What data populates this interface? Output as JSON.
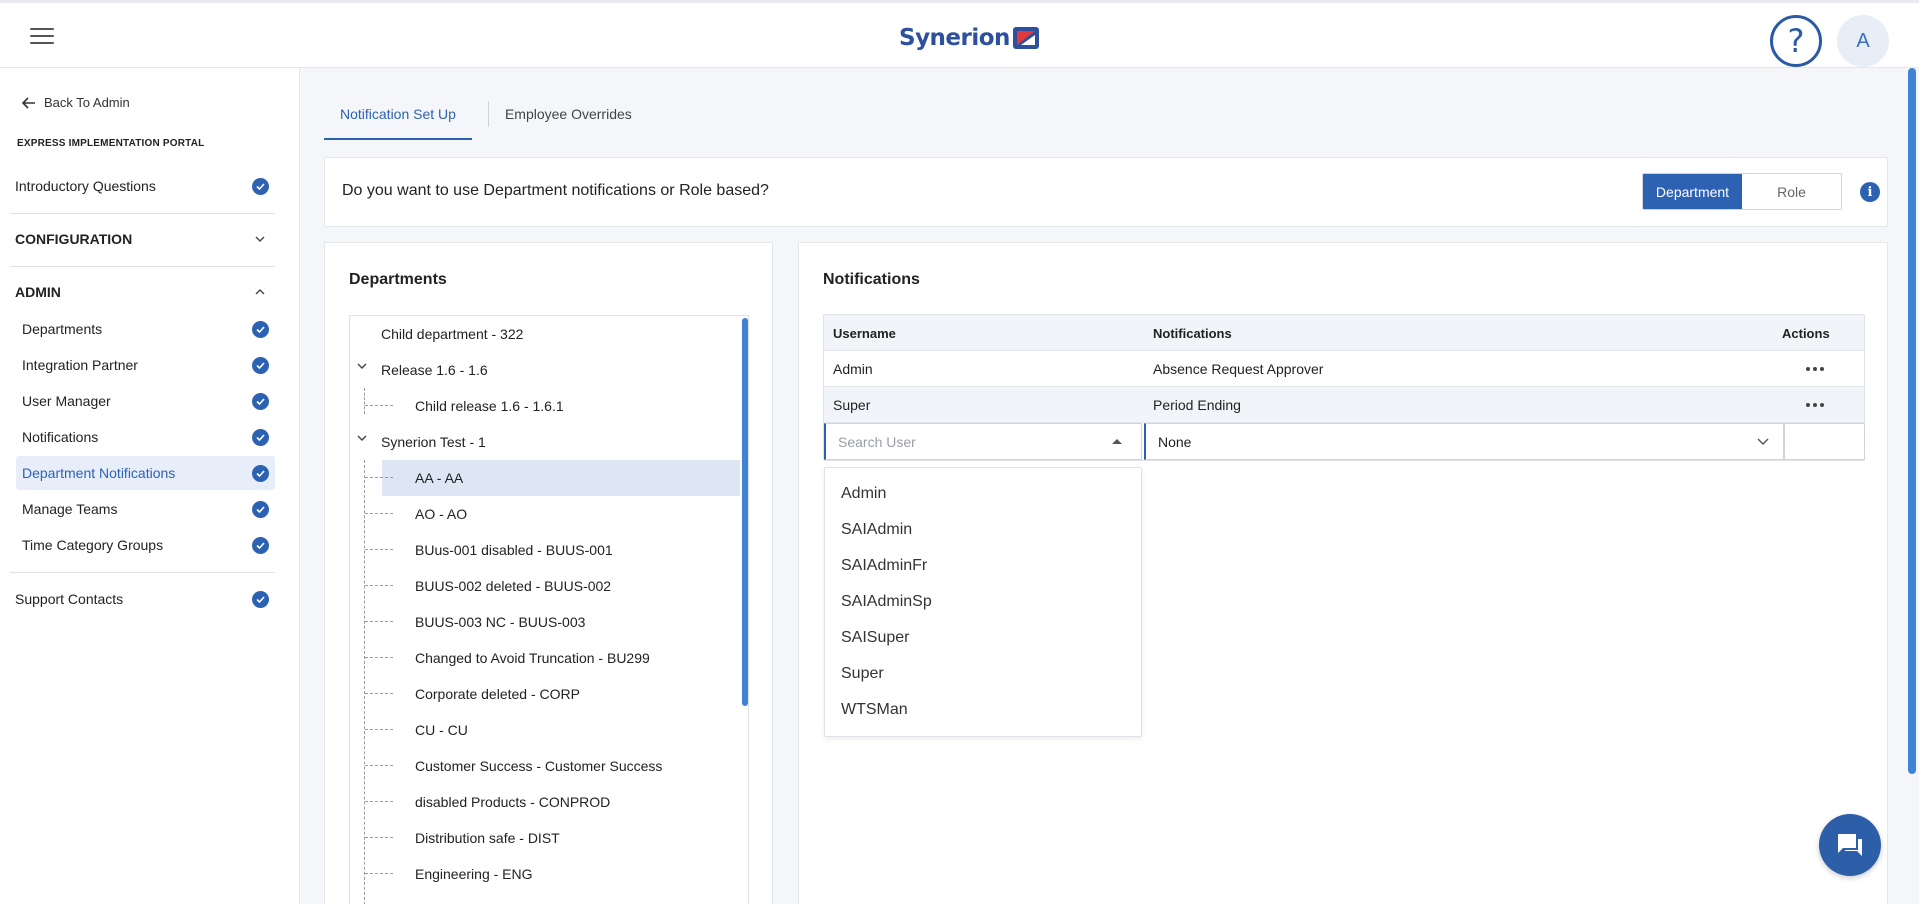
{
  "header": {
    "logo_text": "Synerion",
    "help_glyph": "?",
    "avatar_initial": "A"
  },
  "sidebar": {
    "back_label": "Back To Admin",
    "portal_label": "EXPRESS IMPLEMENTATION PORTAL",
    "intro": "Introductory Questions",
    "configuration": "CONFIGURATION",
    "admin": "ADMIN",
    "admin_items": [
      {
        "label": "Departments",
        "done": true
      },
      {
        "label": "Integration Partner",
        "done": true
      },
      {
        "label": "User Manager",
        "done": true
      },
      {
        "label": "Notifications",
        "done": true
      },
      {
        "label": "Department Notifications",
        "done": true,
        "active": true
      },
      {
        "label": "Manage Teams",
        "done": true
      },
      {
        "label": "Time Category Groups",
        "done": true
      }
    ],
    "support": "Support Contacts"
  },
  "tabs": [
    {
      "label": "Notification Set Up",
      "active": true
    },
    {
      "label": "Employee Overrides",
      "active": false
    }
  ],
  "question": {
    "text": "Do you want to use Department notifications or Role based?",
    "options": [
      "Department",
      "Role"
    ],
    "selected": "Department",
    "info_glyph": "i"
  },
  "departments": {
    "title": "Departments",
    "tree": [
      {
        "label": "Child department - 322",
        "level": 0,
        "expandable": false
      },
      {
        "label": "Release 1.6 - 1.6",
        "level": 0,
        "expandable": true
      },
      {
        "label": "Child release 1.6 - 1.6.1",
        "level": 1
      },
      {
        "label": "Synerion Test - 1",
        "level": 0,
        "expandable": true
      },
      {
        "label": "AA - AA",
        "level": 1,
        "selected": true
      },
      {
        "label": "AO - AO",
        "level": 1
      },
      {
        "label": "BUus-001 disabled - BUUS-001",
        "level": 1
      },
      {
        "label": "BUUS-002 deleted - BUUS-002",
        "level": 1
      },
      {
        "label": "BUUS-003 NC - BUUS-003",
        "level": 1
      },
      {
        "label": "Changed to Avoid Truncation - BU299",
        "level": 1
      },
      {
        "label": "Corporate deleted - CORP",
        "level": 1
      },
      {
        "label": "CU - CU",
        "level": 1
      },
      {
        "label": "Customer Success - Customer Success",
        "level": 1
      },
      {
        "label": "disabled Products - CONPROD",
        "level": 1
      },
      {
        "label": "Distribution safe - DIST",
        "level": 1
      },
      {
        "label": "Engineering - ENG",
        "level": 1
      }
    ]
  },
  "notifications": {
    "title": "Notifications",
    "columns": [
      "Username",
      "Notifications",
      "Actions"
    ],
    "rows": [
      {
        "username": "Admin",
        "notification": "Absence Request Approver"
      },
      {
        "username": "Super",
        "notification": "Period Ending"
      }
    ],
    "search_placeholder": "Search User",
    "select_value": "None",
    "user_options": [
      "Admin",
      "SAIAdmin",
      "SAIAdminFr",
      "SAIAdminSp",
      "SAISuper",
      "Super",
      "WTSMan"
    ]
  },
  "colors": {
    "accent": "#2d62b3",
    "active_bg": "#e7eef9",
    "selected_row": "#dde6f4"
  },
  "icons": {
    "menu": "hamburger-icon",
    "back": "arrow-left-icon",
    "check": "check-circle-icon",
    "chat": "chat-icon",
    "info": "info-icon"
  }
}
